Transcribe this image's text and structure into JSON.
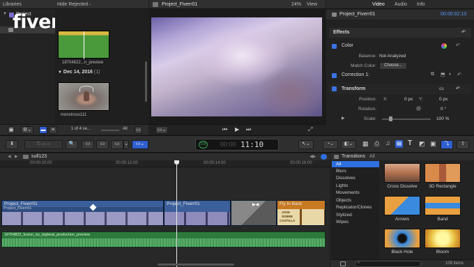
{
  "watermark": "fiverr",
  "libraries": {
    "header": "Libraries",
    "project_name": "Project",
    "hide_rejected": "Hide Rejected",
    "clip1_name": "18704822...n_preview",
    "date_header": "Dec 14, 2016",
    "date_count": "(1)",
    "clip2_name": "monstrous111",
    "page_info": "1 of 4 se...",
    "all_label": "All"
  },
  "viewer": {
    "title": "Project_Fiverr01",
    "zoom": "24%",
    "view_label": "View"
  },
  "inspector": {
    "tabs": [
      "Video",
      "Audio",
      "Info"
    ],
    "project": "Project_Fiverr01",
    "timecode": "00:00:02:13",
    "effects": "Effects",
    "color": "Color",
    "balance_label": "Balance:",
    "balance_value": "Not Analyzed",
    "match_label": "Match Color:",
    "match_value": "Choose...",
    "correction": "Correction 1:",
    "transform": "Transform",
    "position_label": "Position:",
    "x_label": "X:",
    "x_value": "0 px",
    "y_label": "Y:",
    "y_value": "0 px",
    "rotation_label": "Rotation:",
    "rotation_value": "0 °",
    "scale_label": "Scale:",
    "scale_value": "100 %"
  },
  "toolbar": {
    "timecode": "11:10",
    "timecode_prefix": "00:00"
  },
  "timeline": {
    "name": "sull123",
    "ticks": [
      "00:00:10:00",
      "00:00:12:00",
      "00:00:14:00",
      "00:00:16:00"
    ],
    "clip1": "Project_Fiverr01",
    "clip1_sub": "Project_Fiverr01",
    "clip2": "Project_Fiverr01",
    "clip3": "Fly In Back",
    "audio_clip": "18704822_fusion_by_bigbeat_production_preview",
    "thumb_labels": [
      "JOSE",
      "SOBRE",
      "CASTILLA"
    ]
  },
  "transitions": {
    "title": "Transitions",
    "all_label": "All",
    "categories": [
      "All",
      "Blurs",
      "Dissolves",
      "Lights",
      "Movements",
      "Objects",
      "Replicator/Clones",
      "Stylized",
      "Wipes"
    ],
    "items": [
      "Cross Dissolve",
      "3D Rectangle",
      "Arrows",
      "Band",
      "Black Hole",
      "Bloom"
    ],
    "count": "109 items"
  },
  "colors": {
    "accent": "#2f6fe0",
    "clip_blue": "#3b5f9a",
    "clip_orange": "#c87a22",
    "audio_green": "#2d7a3c"
  }
}
